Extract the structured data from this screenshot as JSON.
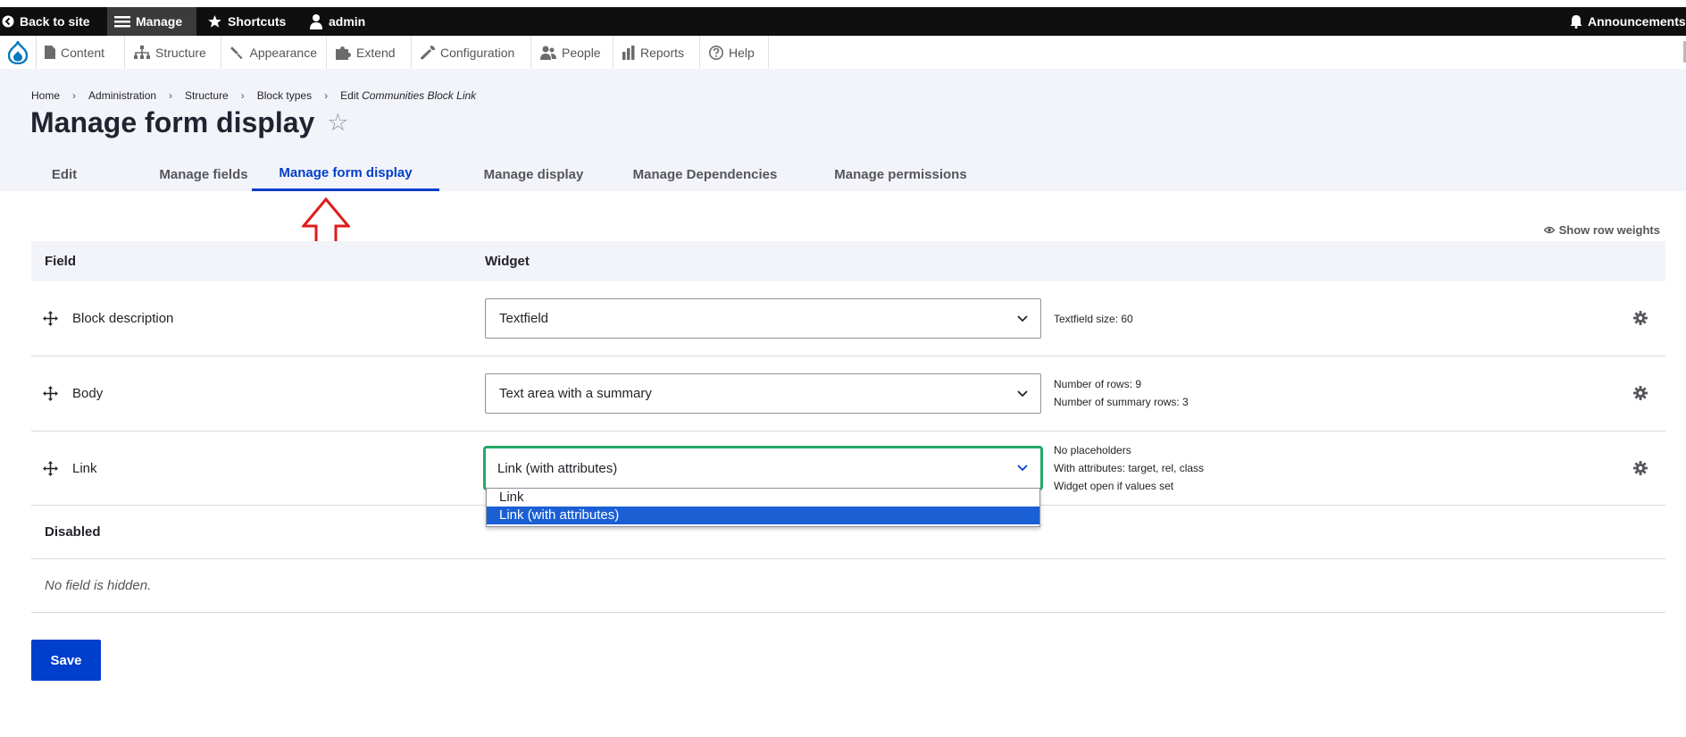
{
  "toolbar": {
    "back_to_site": "Back to site",
    "manage": "Manage",
    "shortcuts": "Shortcuts",
    "user": "admin",
    "announcements": "Announcements"
  },
  "tray": {
    "items": [
      {
        "label": "Content",
        "icon": "file-icon"
      },
      {
        "label": "Structure",
        "icon": "sitemap-icon"
      },
      {
        "label": "Appearance",
        "icon": "paintbrush-icon"
      },
      {
        "label": "Extend",
        "icon": "puzzle-icon"
      },
      {
        "label": "Configuration",
        "icon": "wrench-icon"
      },
      {
        "label": "People",
        "icon": "people-icon"
      },
      {
        "label": "Reports",
        "icon": "bar-chart-icon"
      },
      {
        "label": "Help",
        "icon": "help-icon"
      }
    ]
  },
  "breadcrumb": {
    "items": [
      "Home",
      "Administration",
      "Structure",
      "Block types"
    ],
    "current_prefix": "Edit ",
    "current_em": "Communities Block Link"
  },
  "page": {
    "title": "Manage form display",
    "star": "☆"
  },
  "tabs": [
    {
      "label": "Edit",
      "active": false
    },
    {
      "label": "Manage fields",
      "active": false
    },
    {
      "label": "Manage form display",
      "active": true
    },
    {
      "label": "Manage display",
      "active": false
    },
    {
      "label": "Manage Dependencies",
      "active": false
    },
    {
      "label": "Manage permissions",
      "active": false
    }
  ],
  "show_row_weights": "Show row weights",
  "table": {
    "headers": {
      "field": "Field",
      "widget": "Widget"
    },
    "rows": [
      {
        "field": "Block description",
        "widget": "Textfield",
        "summary": [
          "Textfield size: 60"
        ]
      },
      {
        "field": "Body",
        "widget": "Text area with a summary",
        "summary": [
          "Number of rows: 9",
          "Number of summary rows: 3"
        ]
      },
      {
        "field": "Link",
        "widget": "Link (with attributes)",
        "summary": [
          "No placeholders",
          "With attributes: target, rel, class",
          "Widget open if values set"
        ]
      }
    ],
    "dropdown_options": [
      "Link",
      "Link (with attributes)"
    ],
    "dropdown_selected": "Link (with attributes)",
    "disabled_label": "Disabled",
    "no_hidden": "No field is hidden."
  },
  "save_button": "Save",
  "colors": {
    "accent": "#003ecc",
    "focus_green": "#26a769",
    "annotation_arrow": "#e01b1b"
  }
}
